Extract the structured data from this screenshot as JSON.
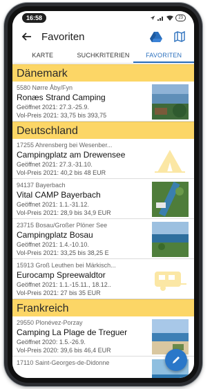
{
  "status_bar": {
    "time": "16:58",
    "battery": "23"
  },
  "app_bar": {
    "title": "Favoriten",
    "icons": [
      "back-arrow-icon",
      "google-drive-icon",
      "map-icon"
    ]
  },
  "tabs": [
    {
      "label": "KARTE",
      "active": false
    },
    {
      "label": "SUCHKRITERIEN",
      "active": false
    },
    {
      "label": "FAVORITEN",
      "active": true
    }
  ],
  "sections": [
    {
      "country": "Dänemark",
      "items": [
        {
          "location": "5580 Nørre Åby/Fyn",
          "name": "Ronæs Strand Camping",
          "open": "Geöffnet 2021: 27.3.-25.9.",
          "price": "Vol-Preis 2021: 33,75 bis 393,75",
          "thumb": "photo-coast"
        }
      ]
    },
    {
      "country": "Deutschland",
      "items": [
        {
          "location": "17255 Ahrensberg bei Wesenber...",
          "name": "Campingplatz am Drewensee",
          "open": "Geöffnet 2021: 27.3.-31.10.",
          "price": "Vol-Preis 2021: 40,2 bis 48 EUR",
          "thumb": "tent-placeholder"
        },
        {
          "location": "94137 Bayerbach",
          "name": "Vital CAMP Bayerbach",
          "open": "Geöffnet 2021: 1.1.-31.12.",
          "price": "Vol-Preis 2021: 28,9 bis 34,9 EUR",
          "thumb": "photo-aerial"
        },
        {
          "location": "23715 Bosau/Großer Plöner See",
          "name": "Campingplatz Bosau",
          "open": "Geöffnet 2021: 1.4.-10.10.",
          "price": "Vol-Preis 2021: 33,25 bis 38,25 E",
          "thumb": "photo-lake"
        },
        {
          "location": "15913 Groß Leuthen bei Märkisch...",
          "name": "Eurocamp Spreewaldtor",
          "open": "Geöffnet 2021: 1.1.-15.11., 18.12..",
          "price": "Vol-Preis 2021: 27 bis 35 EUR",
          "thumb": "caravan-placeholder"
        }
      ]
    },
    {
      "country": "Frankreich",
      "items": [
        {
          "location": "29550 Plonévez-Porzay",
          "name": "Camping La Plage de Treguer",
          "open": "Geöffnet 2020: 1.5.-26.9.",
          "price": "Vol-Preis 2020: 39,6 bis 46,4 EUR",
          "thumb": "photo-beach"
        },
        {
          "location": "17110 Saint-Georges-de-Didonne",
          "name": "",
          "open": "",
          "price": "",
          "thumb": "photo-sea"
        }
      ]
    }
  ],
  "fab": {
    "icon": "edit-pencil-icon"
  },
  "colors": {
    "section": "#fcd666",
    "accent": "#2a6fbd",
    "fab": "#2a77c9"
  }
}
